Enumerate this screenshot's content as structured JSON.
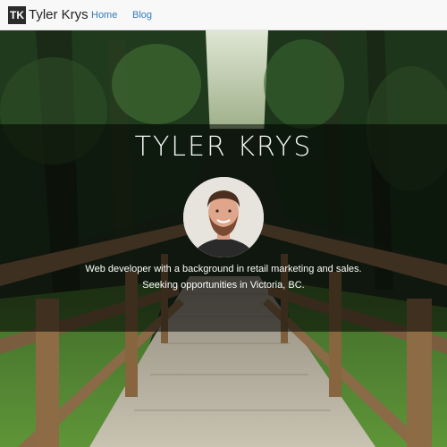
{
  "navbar": {
    "brand_initials": "TK",
    "brand_name": "Tyler Krys",
    "links": [
      {
        "label": "Home"
      },
      {
        "label": "Blog"
      }
    ]
  },
  "hero": {
    "title": "TYLER KRYS",
    "tagline_line1": "Web developer with a background in retail marketing and sales.",
    "tagline_line2": "Seeking opportunities in Victoria, BC.",
    "background_image": "forest-boardwalk",
    "profile_image": "profile-photo"
  },
  "colors": {
    "nav_bg": "#f8f8f8",
    "link": "#337ab7",
    "overlay": "rgba(0,0,0,0.55)",
    "title": "#f4f4f4"
  }
}
